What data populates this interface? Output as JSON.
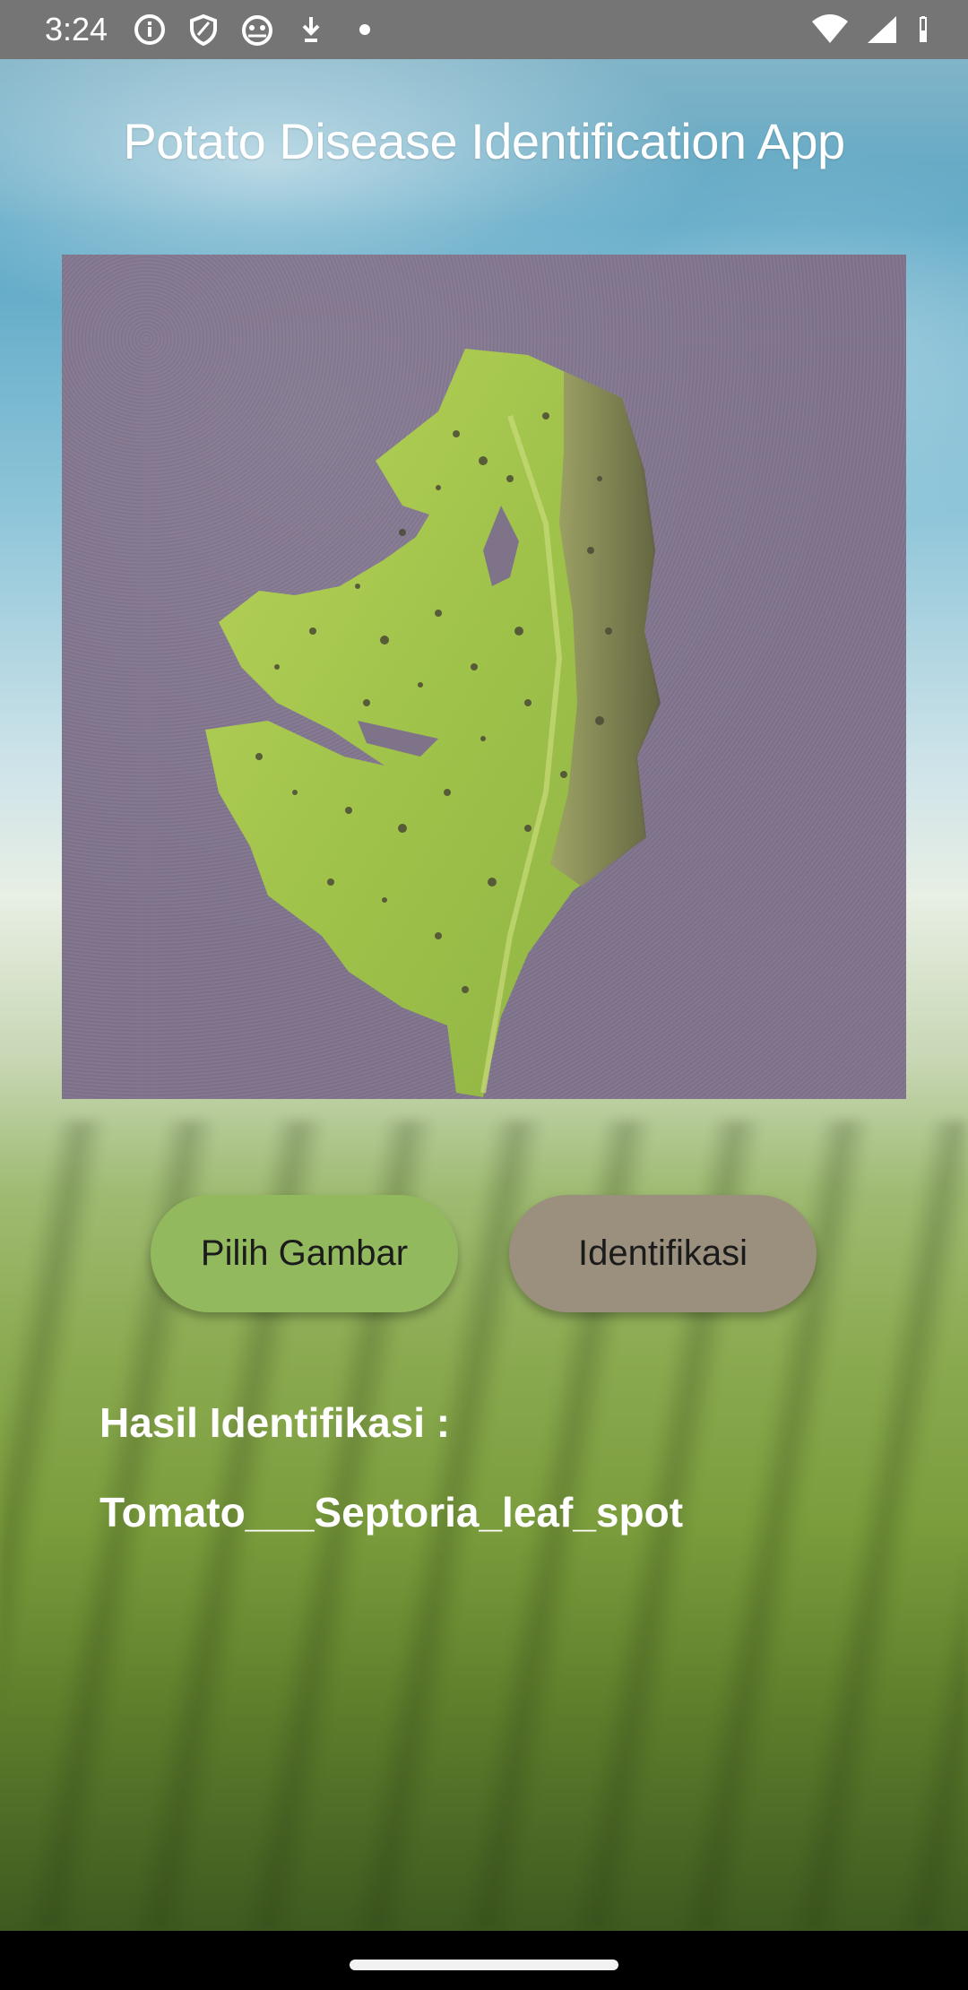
{
  "status_bar": {
    "time": "3:24",
    "left_icons": [
      "info-icon",
      "shield-icon",
      "cat-face-icon",
      "download-icon",
      "dot-icon"
    ],
    "right_icons": [
      "wifi-icon",
      "signal-icon",
      "battery-icon"
    ]
  },
  "app": {
    "title": "Potato Disease Identification App"
  },
  "image": {
    "description_icon": "leaf-photo"
  },
  "buttons": {
    "pick_label": "Pilih Gambar",
    "identify_label": "Identifikasi"
  },
  "result": {
    "label": "Hasil Identifikasi :",
    "value": "Tomato___Septoria_leaf_spot"
  },
  "colors": {
    "pick_button": "#92b95e",
    "identify_button": "#9b8f7d",
    "status_bar": "#757575"
  }
}
